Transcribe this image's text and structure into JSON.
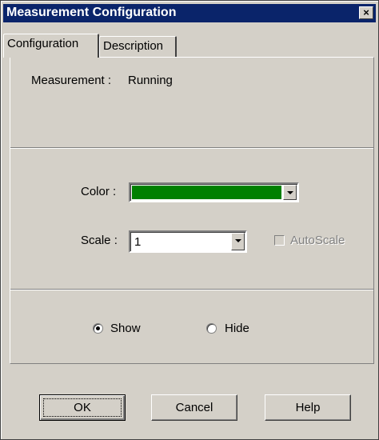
{
  "window": {
    "title": "Measurement Configuration",
    "close_glyph": "×"
  },
  "tabs": [
    {
      "label": "Configuration",
      "active": true
    },
    {
      "label": "Description",
      "active": false
    }
  ],
  "configuration": {
    "measurement_label": "Measurement :",
    "measurement_value": "Running",
    "color_label": "Color :",
    "color_value": "#008000",
    "scale_label": "Scale :",
    "scale_value": "1",
    "autoscale_label": "AutoScale",
    "autoscale_checked": false,
    "autoscale_enabled": false,
    "visibility": {
      "selected": "show",
      "options": [
        {
          "id": "show",
          "label": "Show"
        },
        {
          "id": "hide",
          "label": "Hide"
        }
      ]
    }
  },
  "buttons": {
    "ok": "OK",
    "cancel": "Cancel",
    "help": "Help"
  }
}
